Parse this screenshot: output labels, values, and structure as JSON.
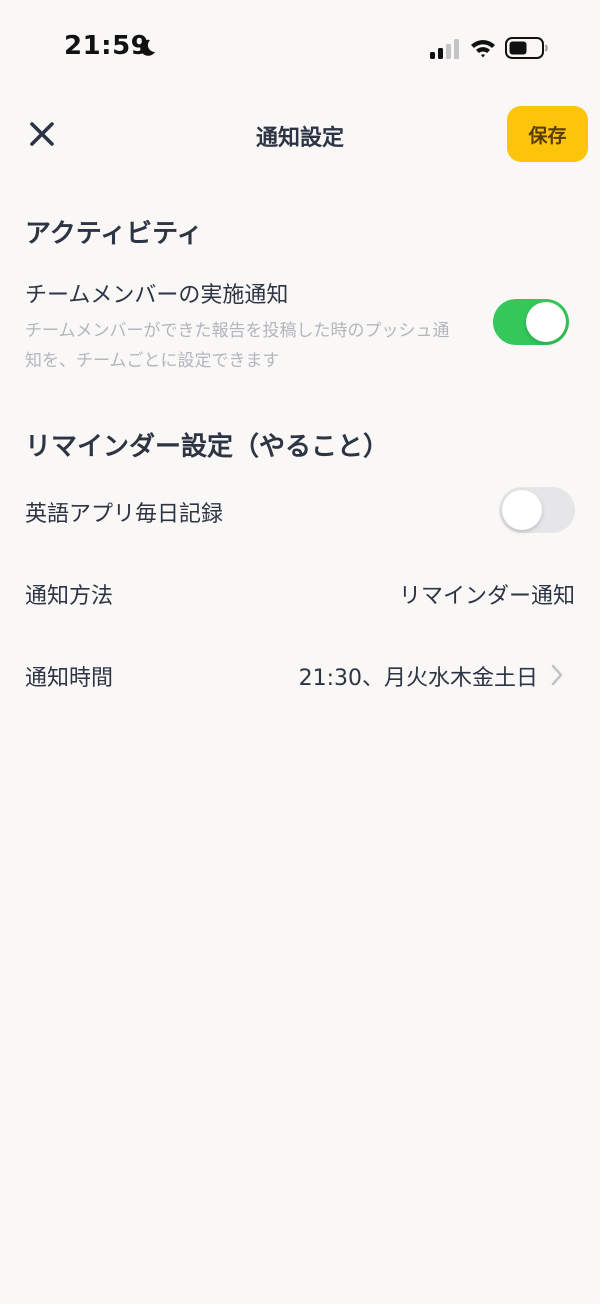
{
  "status_bar": {
    "time": "21:59",
    "icons": [
      "moon-icon",
      "cellular-signal-icon",
      "wifi-icon",
      "battery-icon"
    ]
  },
  "header": {
    "close_icon": "close-icon",
    "title": "通知設定",
    "save_label": "保存"
  },
  "colors": {
    "accent": "#fcc50b",
    "toggle_on": "#34c759",
    "toggle_off": "#e6e6e8",
    "text_primary": "#2d3444",
    "text_secondary": "#b3b6bd",
    "background": "#f9f8f6"
  },
  "sections": [
    {
      "title": "アクティビティ",
      "rows": [
        {
          "label": "チームメンバーの実施通知",
          "description": "チームメンバーができた報告を投稿した時のプッシュ通知を、チームごとに設定できます",
          "toggle_on": true
        }
      ]
    },
    {
      "title": "リマインダー設定（やること）",
      "rows": [
        {
          "label": "英語アプリ毎日記録",
          "toggle_on": false
        },
        {
          "label": "通知方法",
          "value": "リマインダー通知"
        },
        {
          "label": "通知時間",
          "value": "21:30、月火水木金土日",
          "chevron_icon": "chevron-right-icon"
        }
      ]
    }
  ]
}
